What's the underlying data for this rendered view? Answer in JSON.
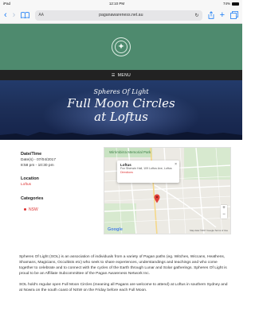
{
  "status_bar": {
    "carrier": "iPad",
    "time": "12:10 PM",
    "battery": "74%"
  },
  "browser": {
    "url": "paganawareness.net.au",
    "text_size_label": "AA",
    "icons": [
      "back-icon",
      "forward-icon",
      "bookmarks-icon",
      "reload-icon",
      "share-icon",
      "new-tab-icon",
      "tabs-icon"
    ]
  },
  "site": {
    "menu_label": "MENU",
    "colors": {
      "header": "#4e8a6e",
      "menu": "#222222",
      "accent": "#dd3333"
    }
  },
  "hero": {
    "line1": "Spheres Of Light",
    "line2": "Full Moon Circles",
    "line3": "at Loftus"
  },
  "event": {
    "datetime_heading": "Date/Time",
    "date": "Date(s) - 07/04/2017",
    "time": "8:58 pm - 10:30 pm",
    "location_heading": "Location",
    "location": "Loftus",
    "categories_heading": "Categories",
    "category": "NSW"
  },
  "map": {
    "park_label": "Wirrimbirra Memorial Park",
    "popup_title": "Loftus",
    "popup_address": "Fox Sherwin Hall, 109 Loftus Ave, Loftus",
    "popup_link": "Directions",
    "brand": "Google",
    "attribution": "Map data ©2017 Google   Terms of Use",
    "zoom_in": "+",
    "zoom_out": "−"
  },
  "description": {
    "para1": "Spheres Of Light (SOL) is an association of individuals from a variety of Pagan paths (eg. Witches, Wiccans, Heathens, Shamans, Magicians, Occultists etc) who seek to share experiences, understandings and teachings and who come together to celebrate and to connect with the cycles of the Earth through Lunar and Solar gatherings. Spheres Of Light is proud to be an Affiliate Subcommittee of the Pagan Awareness Network Inc.",
    "para2": "SOL hold's regular open Full Moon Circles (meaning all Pagans are welcome to attend) at Loftus in southern Sydney and at Nowra on the south coast of NSW on the Friday before each Full Moon."
  }
}
